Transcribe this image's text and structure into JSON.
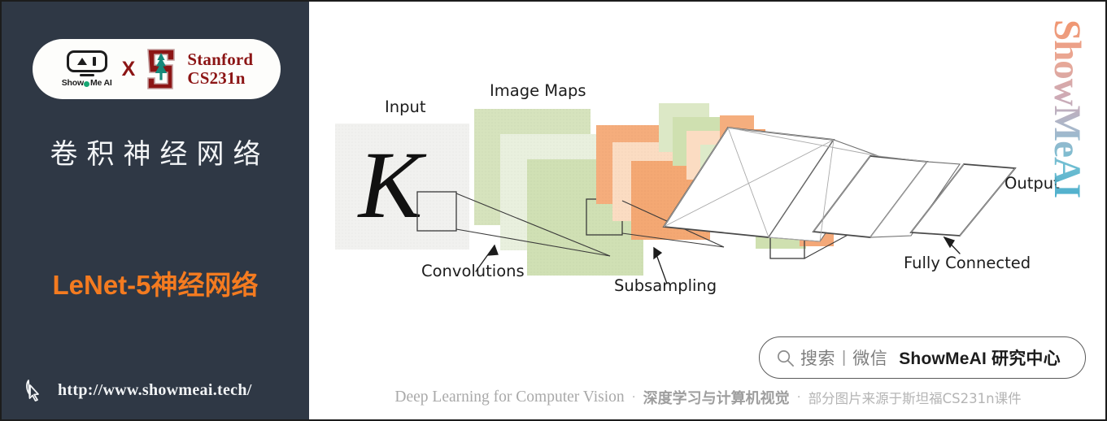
{
  "sidebar": {
    "badge": {
      "showmeai_logo_text": "Show",
      "showmeai_logo_text2": "Me AI",
      "x_symbol": "X",
      "stanford_line1": "Stanford",
      "stanford_line2": "CS231n"
    },
    "title": "卷积神经网络",
    "subtitle": "LeNet-5神经网络",
    "url": "http://www.showmeai.tech/",
    "colors": {
      "background": "#2f3845",
      "title": "#f2f4f6",
      "accent_orange": "#F47B20",
      "stanford_red": "#8C1515",
      "tree_green": "#1d8a77"
    }
  },
  "diagram": {
    "labels": {
      "input": "Input",
      "image_maps": "Image Maps",
      "convolutions": "Convolutions",
      "subsampling": "Subsampling",
      "fully_connected": "Fully Connected",
      "output": "Output"
    },
    "input_glyph": "K",
    "colors": {
      "green_map": "#cfdfb6",
      "green_map_light": "#e4eed6",
      "orange_map": "#f4ab78",
      "orange_map_light": "#fadcc4",
      "input_bg": "#f1f1ef",
      "stroke": "#3a3a3a"
    }
  },
  "watermark": {
    "text": "ShowMeAI"
  },
  "search": {
    "icon": "search-icon",
    "label": "搜索",
    "separator": "|",
    "channel": "微信",
    "brand": "ShowMeAI 研究中心"
  },
  "footer": {
    "english": "Deep Learning for Computer Vision",
    "dot1": "·",
    "chinese": "深度学习与计算机视觉",
    "dot2": "·",
    "note": "部分图片来源于斯坦福CS231n课件"
  }
}
